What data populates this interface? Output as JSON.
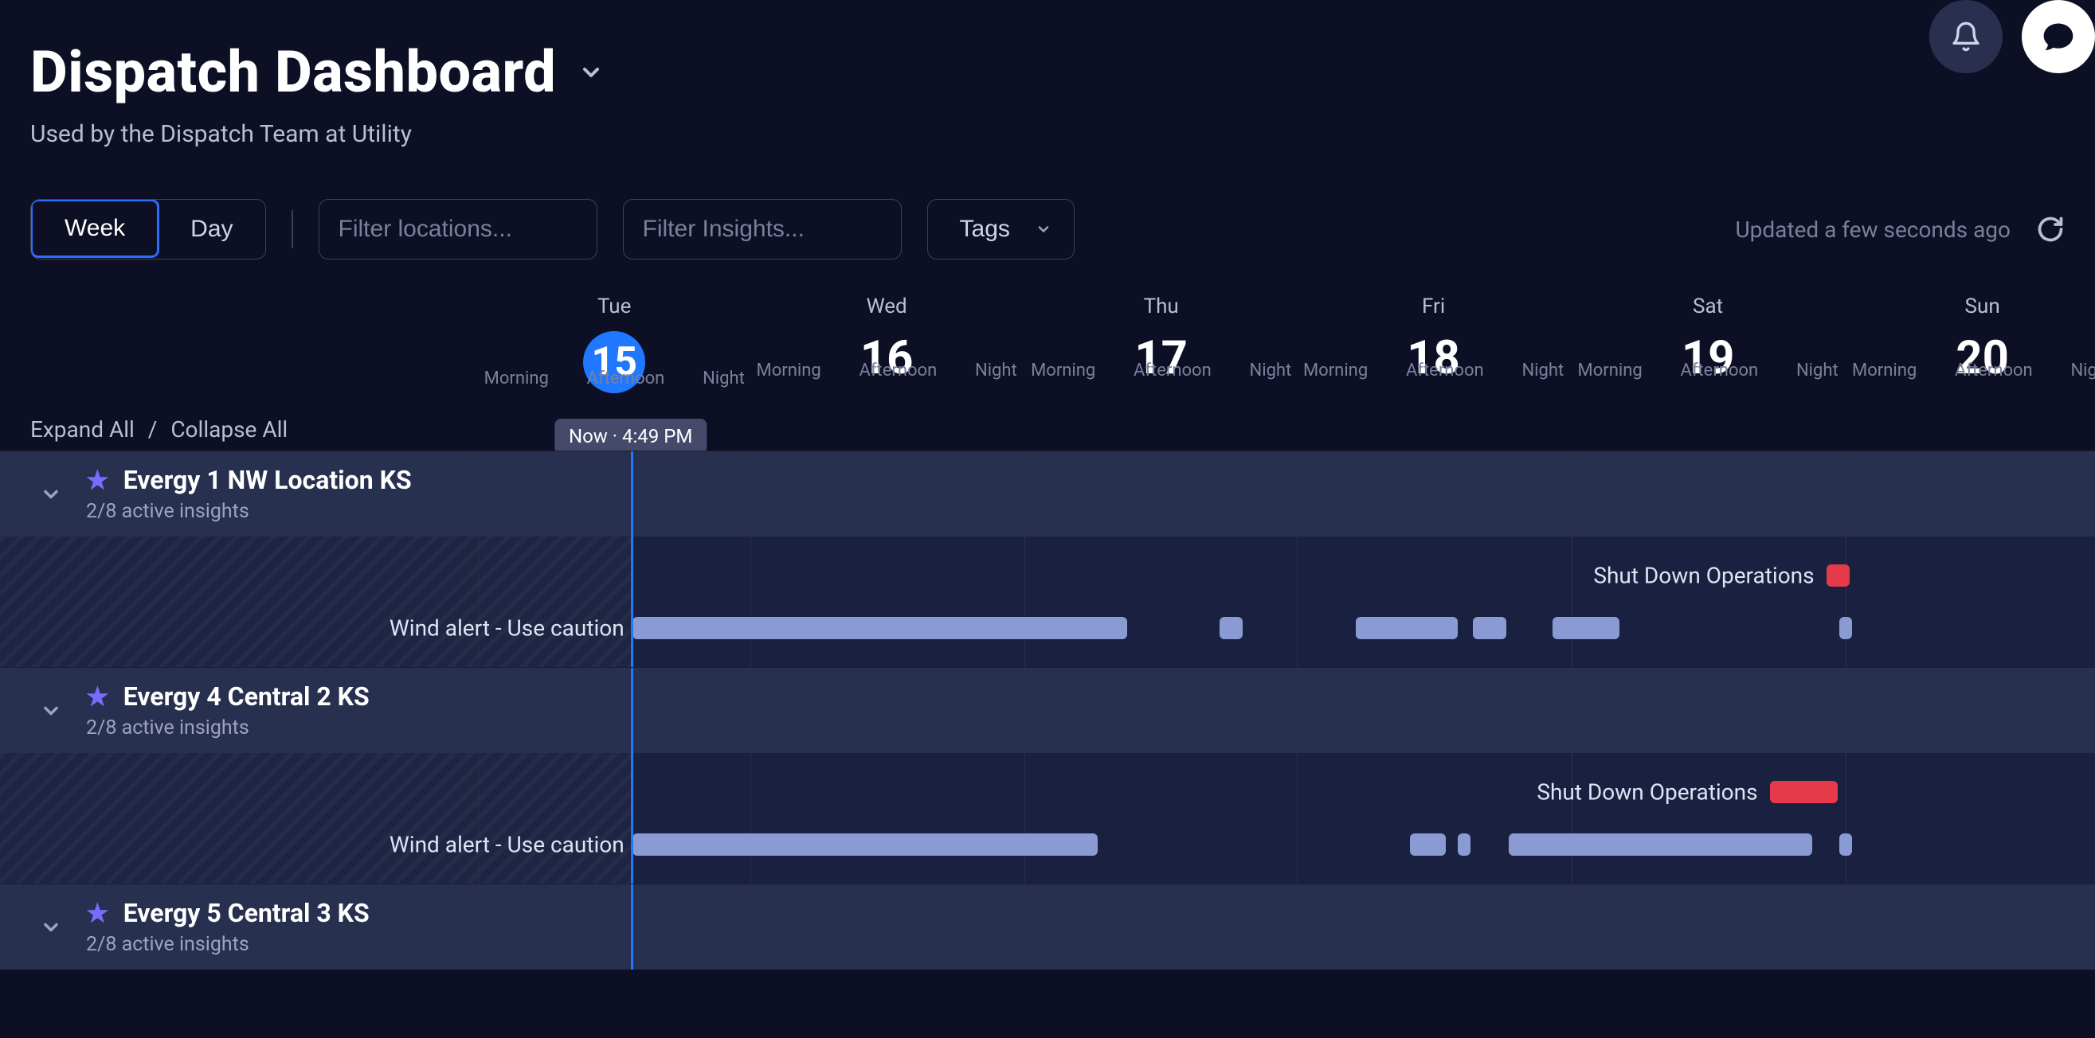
{
  "header": {
    "title": "Dispatch Dashboard",
    "subtitle": "Used by the Dispatch Team at Utility"
  },
  "controls": {
    "view_week": "Week",
    "view_day": "Day",
    "filter_locations_placeholder": "Filter locations...",
    "filter_insights_placeholder": "Filter Insights...",
    "tags_label": "Tags",
    "updated_text": "Updated a few seconds ago"
  },
  "expand_all": "Expand All",
  "collapse_all": "Collapse All",
  "separator": "/",
  "now_label": "Now · 4:49 PM",
  "timeofday": {
    "morning": "Morning",
    "afternoon": "Afternoon",
    "night": "Night"
  },
  "days": [
    {
      "abbr": "Tue",
      "num": "15",
      "today": true,
      "leftPct": 22.8
    },
    {
      "abbr": "Wed",
      "num": "16",
      "today": false,
      "leftPct": 35.8
    },
    {
      "abbr": "Thu",
      "num": "17",
      "today": false,
      "leftPct": 48.9
    },
    {
      "abbr": "Fri",
      "num": "18",
      "today": false,
      "leftPct": 61.9
    },
    {
      "abbr": "Sat",
      "num": "19",
      "today": false,
      "leftPct": 75.0
    },
    {
      "abbr": "Sun",
      "num": "20",
      "today": false,
      "leftPct": 88.1
    }
  ],
  "dayWidthPct": 13.05,
  "nowLinePct": 30.1,
  "locations": [
    {
      "name": "Evergy 1 NW Location KS",
      "sub": "2/8 active insights",
      "insights": [
        {
          "label": "Shut Down Operations",
          "label_right_of": true,
          "bars": [
            {
              "leftPct": 87.2,
              "widthPct": 1.1,
              "color": "red"
            }
          ]
        },
        {
          "label": "Wind alert - Use caution",
          "bars": [
            {
              "leftPct": 30.2,
              "widthPct": 23.6,
              "color": "blue"
            },
            {
              "leftPct": 58.2,
              "widthPct": 1.1,
              "color": "blue"
            },
            {
              "leftPct": 64.7,
              "widthPct": 4.9,
              "color": "blue"
            },
            {
              "leftPct": 70.3,
              "widthPct": 1.6,
              "color": "blue"
            },
            {
              "leftPct": 74.1,
              "widthPct": 3.2,
              "color": "blue"
            },
            {
              "leftPct": 87.8,
              "widthPct": 0.6,
              "color": "blue"
            }
          ]
        }
      ]
    },
    {
      "name": "Evergy 4 Central 2 KS",
      "sub": "2/8 active insights",
      "insights": [
        {
          "label": "Shut Down Operations",
          "label_right_of": true,
          "bars": [
            {
              "leftPct": 84.5,
              "widthPct": 3.2,
              "color": "red"
            }
          ]
        },
        {
          "label": "Wind alert - Use caution",
          "bars": [
            {
              "leftPct": 30.2,
              "widthPct": 22.2,
              "color": "blue"
            },
            {
              "leftPct": 67.3,
              "widthPct": 1.7,
              "color": "blue"
            },
            {
              "leftPct": 69.6,
              "widthPct": 0.6,
              "color": "blue"
            },
            {
              "leftPct": 72.0,
              "widthPct": 14.5,
              "color": "blue"
            },
            {
              "leftPct": 87.8,
              "widthPct": 0.6,
              "color": "blue"
            }
          ]
        }
      ]
    },
    {
      "name": "Evergy 5 Central 3 KS",
      "sub": "2/8 active insights",
      "insights": []
    }
  ]
}
